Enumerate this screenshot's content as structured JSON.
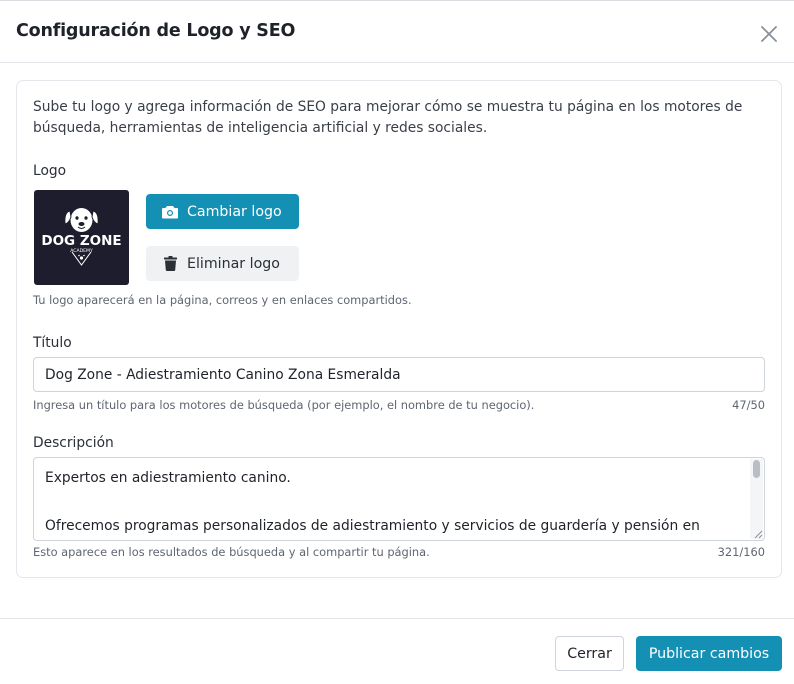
{
  "modal": {
    "title": "Configuración de Logo y SEO"
  },
  "intro": "Sube tu logo y agrega información de SEO para mejorar cómo se muestra tu página en los motores de búsqueda, herramientas de inteligencia artificial y redes sociales.",
  "logo_section": {
    "label": "Logo",
    "brand_line1": "DOG ZONE",
    "brand_line2": "ACADEMY",
    "change_button": "Cambiar logo",
    "remove_button": "Eliminar logo",
    "help": "Tu logo aparecerá en la página, correos y en enlaces compartidos."
  },
  "title_field": {
    "label": "Título",
    "value": "Dog Zone - Adiestramiento Canino Zona Esmeralda",
    "help": "Ingresa un título para los motores de búsqueda (por ejemplo, el nombre de tu negocio).",
    "counter": "47/50"
  },
  "description_field": {
    "label": "Descripción",
    "value": "Expertos en adiestramiento canino.\n\nOfrecemos programas personalizados de adiestramiento y servicios de guardería y pensión en",
    "help": "Esto aparece en los resultados de búsqueda y al compartir tu página.",
    "counter": "321/160"
  },
  "footer": {
    "close_button": "Cerrar",
    "publish_button": "Publicar cambios"
  },
  "colors": {
    "primary": "#1490b4",
    "logo_background": "#1d1d2d"
  },
  "icons": {
    "close": "close-icon",
    "camera": "camera-icon",
    "trash": "trash-icon"
  }
}
